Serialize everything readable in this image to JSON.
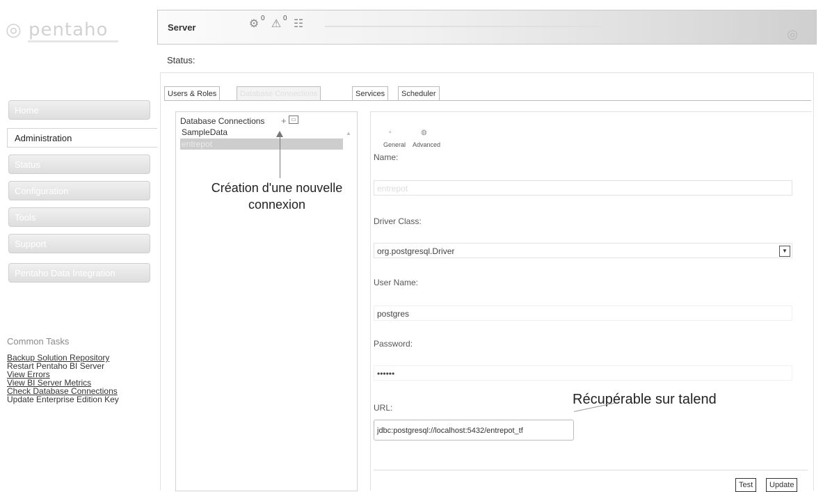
{
  "logo": {
    "text": "pentaho"
  },
  "server_bar": {
    "title": "Server",
    "counts": [
      "0",
      "0"
    ]
  },
  "status": {
    "label": "Status:"
  },
  "nav": {
    "items": [
      "Home",
      "Administration",
      "Status",
      "Configuration",
      "Tools",
      "Support",
      "Pentaho Data Integration"
    ],
    "active_index": 1
  },
  "tasks": {
    "title": "Common Tasks",
    "links": [
      "Backup Solution Repository",
      "Restart Pentaho BI Server",
      "View Errors",
      "View BI Server Metrics",
      "Check Database Connections",
      "Update Enterprise Edition Key"
    ]
  },
  "tabs": {
    "items": [
      "Users & Roles",
      "Database Connections",
      "Services",
      "Scheduler"
    ],
    "active_index": 1
  },
  "connections": {
    "header": "Database Connections",
    "add_symbol": "+",
    "items": [
      "SampleData",
      "entrepot"
    ],
    "selected_index": 1
  },
  "annotations": {
    "new_connection": "Création d'une nouvelle connexion",
    "talend": "Récupérable sur talend"
  },
  "detail": {
    "mini_tabs": [
      "General",
      "Advanced"
    ],
    "name_label": "Name:",
    "name_value": "entrepot",
    "driver_label": "Driver Class:",
    "driver_value": "org.postgresql.Driver",
    "user_label": "User Name:",
    "user_value": "postgres",
    "password_label": "Password:",
    "password_value": "••••••",
    "url_label": "URL:",
    "url_value": "jdbc:postgresql://localhost:5432/entrepot_tf",
    "buttons": [
      "Test",
      "Update"
    ]
  }
}
